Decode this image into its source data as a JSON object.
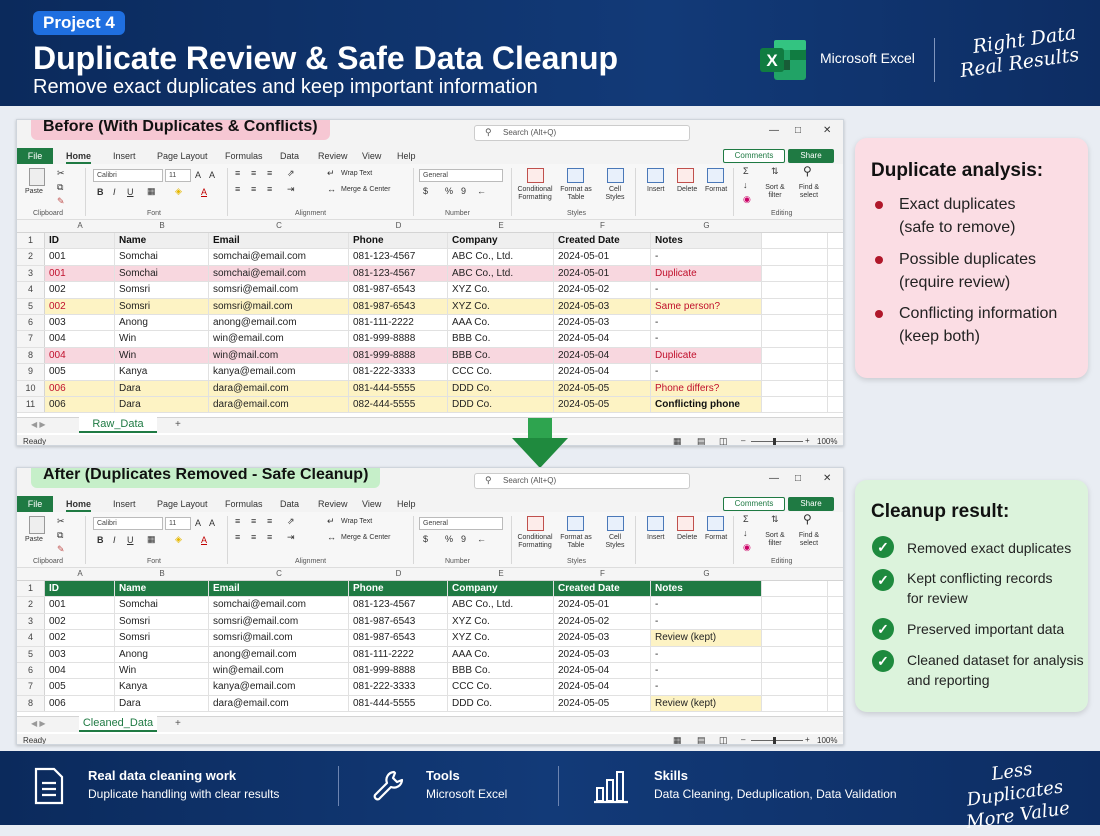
{
  "header": {
    "badge": "Project 4",
    "title": "Duplicate Review & Safe Data Cleanup",
    "subtitle": "Remove exact duplicates and keep important information",
    "app_name": "Microsoft Excel",
    "slogan_line1": "Right Data",
    "slogan_line2": "Real Results"
  },
  "excel": {
    "search_placeholder": "Search (Alt+Q)",
    "menu": [
      "File",
      "Home",
      "Insert",
      "Page Layout",
      "Formulas",
      "Data",
      "Review",
      "View",
      "Help"
    ],
    "comments_label": "Comments",
    "share_label": "Share",
    "ribbon": {
      "paste": "Paste",
      "clipboard": "Clipboard",
      "font_name": "Calibri",
      "font_size": "11",
      "font_group": "Font",
      "wrap_text": "Wrap Text",
      "merge_center": "Merge & Center",
      "alignment_group": "Alignment",
      "number_format": "General",
      "number_group": "Number",
      "conditional_formatting": "Conditional Formatting",
      "format_as_table": "Format as Table",
      "cell_styles": "Cell Styles",
      "styles_group": "Styles",
      "insert": "Insert",
      "delete": "Delete",
      "format": "Format",
      "sort_filter": "Sort & filter",
      "find_select": "Find & select",
      "editing_group": "Editing"
    },
    "columns": [
      "A",
      "B",
      "C",
      "D",
      "E",
      "F",
      "G"
    ],
    "status_ready": "Ready",
    "zoom": "100%"
  },
  "before": {
    "label": "Before (With Duplicates & Conflicts)",
    "sheet_name": "Raw_Data",
    "headers": [
      "ID",
      "Name",
      "Email",
      "Phone",
      "Company",
      "Created Date",
      "Notes"
    ],
    "rows": [
      {
        "cells": [
          "001",
          "Somchai",
          "somchai@email.com",
          "081-123-4567",
          "ABC Co., Ltd.",
          "2024-05-01",
          "-"
        ],
        "status": "normal"
      },
      {
        "cells": [
          "001",
          "Somchai",
          "somchai@email.com",
          "081-123-4567",
          "ABC Co., Ltd.",
          "2024-05-01",
          "Duplicate"
        ],
        "status": "duplicate"
      },
      {
        "cells": [
          "002",
          "Somsri",
          "somsri@email.com",
          "081-987-6543",
          "XYZ Co.",
          "2024-05-02",
          "-"
        ],
        "status": "normal"
      },
      {
        "cells": [
          "002",
          "Somsri",
          "somsri@mail.com",
          "081-987-6543",
          "XYZ Co.",
          "2024-05-03",
          "Same person?"
        ],
        "status": "possible"
      },
      {
        "cells": [
          "003",
          "Anong",
          "anong@email.com",
          "081-111-2222",
          "AAA Co.",
          "2024-05-03",
          "-"
        ],
        "status": "normal"
      },
      {
        "cells": [
          "004",
          "Win",
          "win@email.com",
          "081-999-8888",
          "BBB Co.",
          "2024-05-04",
          "-"
        ],
        "status": "normal"
      },
      {
        "cells": [
          "004",
          "Win",
          "win@mail.com",
          "081-999-8888",
          "BBB Co.",
          "2024-05-04",
          "Duplicate"
        ],
        "status": "duplicate"
      },
      {
        "cells": [
          "005",
          "Kanya",
          "kanya@email.com",
          "081-222-3333",
          "CCC Co.",
          "2024-05-04",
          "-"
        ],
        "status": "normal"
      },
      {
        "cells": [
          "006",
          "Dara",
          "dara@email.com",
          "081-444-5555",
          "DDD Co.",
          "2024-05-05",
          "Phone differs?"
        ],
        "status": "possible"
      },
      {
        "cells": [
          "006",
          "Dara",
          "dara@email.com",
          "082-444-5555",
          "DDD Co.",
          "2024-05-05",
          "Conflicting phone"
        ],
        "status": "conflict"
      }
    ]
  },
  "after": {
    "label": "After (Duplicates Removed - Safe Cleanup)",
    "sheet_name": "Cleaned_Data",
    "headers": [
      "ID",
      "Name",
      "Email",
      "Phone",
      "Company",
      "Created Date",
      "Notes"
    ],
    "rows": [
      {
        "cells": [
          "001",
          "Somchai",
          "somchai@email.com",
          "081-123-4567",
          "ABC Co., Ltd.",
          "2024-05-01",
          "-"
        ],
        "status": "normal"
      },
      {
        "cells": [
          "002",
          "Somsri",
          "somsri@email.com",
          "081-987-6543",
          "XYZ Co.",
          "2024-05-02",
          "-"
        ],
        "status": "normal"
      },
      {
        "cells": [
          "002",
          "Somsri",
          "somsri@mail.com",
          "081-987-6543",
          "XYZ Co.",
          "2024-05-03",
          "Review (kept)"
        ],
        "status": "kept"
      },
      {
        "cells": [
          "003",
          "Anong",
          "anong@email.com",
          "081-111-2222",
          "AAA Co.",
          "2024-05-03",
          "-"
        ],
        "status": "normal"
      },
      {
        "cells": [
          "004",
          "Win",
          "win@email.com",
          "081-999-8888",
          "BBB Co.",
          "2024-05-04",
          "-"
        ],
        "status": "normal"
      },
      {
        "cells": [
          "005",
          "Kanya",
          "kanya@email.com",
          "081-222-3333",
          "CCC Co.",
          "2024-05-04",
          "-"
        ],
        "status": "normal"
      },
      {
        "cells": [
          "006",
          "Dara",
          "dara@email.com",
          "081-444-5555",
          "DDD Co.",
          "2024-05-05",
          "Review (kept)"
        ],
        "status": "kept"
      }
    ]
  },
  "analysis": {
    "title": "Duplicate analysis:",
    "items": [
      {
        "line1": "Exact duplicates",
        "line2": "(safe to remove)"
      },
      {
        "line1": "Possible duplicates",
        "line2": "(require review)"
      },
      {
        "line1": "Conflicting information",
        "line2": "(keep both)"
      }
    ]
  },
  "result": {
    "title": "Cleanup result:",
    "items": [
      {
        "line1": "Removed exact duplicates",
        "line2": ""
      },
      {
        "line1": "Kept conflicting records",
        "line2": "for review"
      },
      {
        "line1": "Preserved important data",
        "line2": ""
      },
      {
        "line1": "Cleaned dataset for analysis",
        "line2": "and reporting"
      }
    ]
  },
  "footer": {
    "items": [
      {
        "title": "Real data cleaning work",
        "sub": "Duplicate handling with clear results",
        "icon": "document-icon"
      },
      {
        "title": "Tools",
        "sub": "Microsoft Excel",
        "icon": "wrench-icon"
      },
      {
        "title": "Skills",
        "sub": "Data Cleaning, Deduplication, Data Validation",
        "icon": "bar-chart-icon"
      }
    ],
    "slogan_line1": "Less Duplicates",
    "slogan_line2": "More Value"
  },
  "colors": {
    "excel_green": "#1f7a43",
    "duplicate_row": "#f8d7df",
    "possible_row": "#fdf3c4",
    "duplicate_text": "#c0102c",
    "header_navy": "#0b2a5c",
    "before_label": "#f6c7d3",
    "after_label": "#c6efc9"
  }
}
